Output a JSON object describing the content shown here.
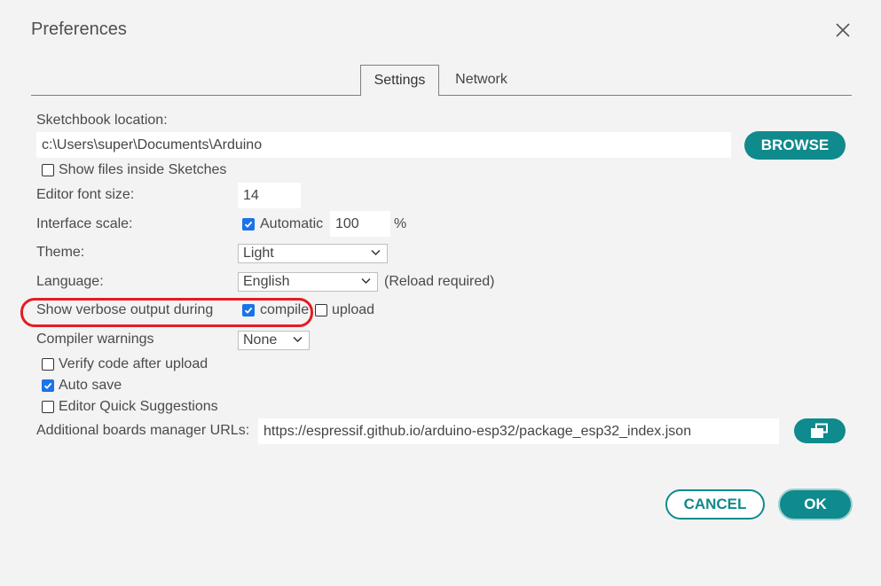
{
  "dialog": {
    "title": "Preferences"
  },
  "tabs": [
    {
      "label": "Settings",
      "active": true
    },
    {
      "label": "Network",
      "active": false
    }
  ],
  "sketchbook": {
    "label": "Sketchbook location:",
    "path": "c:\\Users\\super\\Documents\\Arduino",
    "browse_label": "BROWSE",
    "show_files_label": "Show files inside Sketches",
    "show_files_checked": false
  },
  "editor_font": {
    "label": "Editor font size:",
    "value": "14"
  },
  "interface_scale": {
    "label": "Interface scale:",
    "auto_label": "Automatic",
    "auto_checked": true,
    "value": "100",
    "unit": "%"
  },
  "theme": {
    "label": "Theme:",
    "value": "Light"
  },
  "language": {
    "label": "Language:",
    "value": "English",
    "note": "(Reload required)"
  },
  "verbose": {
    "label": "Show verbose output during",
    "compile_label": "compile",
    "compile_checked": true,
    "upload_label": "upload",
    "upload_checked": false
  },
  "compiler_warnings": {
    "label": "Compiler warnings",
    "value": "None"
  },
  "verify": {
    "label": "Verify code after upload",
    "checked": false
  },
  "auto_save": {
    "label": "Auto save",
    "checked": true
  },
  "quick_suggestions": {
    "label": "Editor Quick Suggestions",
    "checked": false
  },
  "boards_urls": {
    "label": "Additional boards manager URLs:",
    "value": "https://espressif.github.io/arduino-esp32/package_esp32_index.json"
  },
  "footer": {
    "cancel_label": "CANCEL",
    "ok_label": "OK"
  },
  "colors": {
    "accent": "#0f8a8d",
    "checkbox": "#1a73e8",
    "annotation": "#e51c23"
  }
}
